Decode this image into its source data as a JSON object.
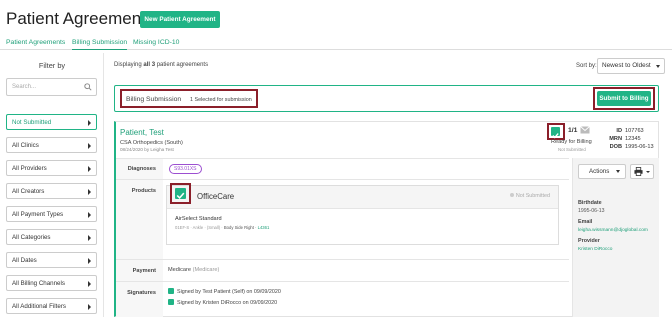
{
  "header": {
    "title": "Patient Agreements",
    "new_button": "New Patient Agreement"
  },
  "tabs": [
    {
      "label": "Patient Agreements"
    },
    {
      "label": "Billing Submission"
    },
    {
      "label": "Missing ICD-10"
    }
  ],
  "filters": {
    "title": "Filter by",
    "search_placeholder": "Search...",
    "items": [
      {
        "label": "Not Submitted"
      },
      {
        "label": "All Clinics"
      },
      {
        "label": "All Providers"
      },
      {
        "label": "All Creators"
      },
      {
        "label": "All Payment Types"
      },
      {
        "label": "All Categories"
      },
      {
        "label": "All Dates"
      },
      {
        "label": "All Billing Channels"
      },
      {
        "label": "All Additional Filters"
      }
    ]
  },
  "list": {
    "displaying_prefix": "Displaying",
    "displaying_count": "all 3",
    "displaying_suffix": "patient agreements",
    "sort_label": "Sort by:",
    "sort_value": "Newest to Oldest"
  },
  "billing_bar": {
    "label": "Billing Submission",
    "selected": "1 Selected for submission",
    "submit_button": "Submit to Billing"
  },
  "agreement": {
    "patient_name": "Patient, Test",
    "org": "CSA Orthopedics (South)",
    "date_line": "08/24/2020 by Leigha Test",
    "ready_count": "1/1",
    "ready_text": "Ready for Billing",
    "ready_sub": "Not Submitted",
    "id_label": "ID",
    "id_value": "107763",
    "mrn_label": "MRN",
    "mrn_value": "12345",
    "dob_label": "DOB",
    "dob_value": "1995-06-13",
    "diagnoses_label": "Diagnoses",
    "diagnosis_code": "S93.01XS",
    "products_label": "Products",
    "product_name": "OfficeCare",
    "product_status": "Not Submitted",
    "product_item": "AirSelect Standard",
    "product_detail_code": "01EF-S · Ankle · (Small) ·",
    "product_detail_side": "Body Side Right ·",
    "product_detail_hcpcs": "L4361",
    "payment_label": "Payment",
    "payment_value": "Medicare",
    "payment_sub": "(Medicare)",
    "signatures_label": "Signatures",
    "signatures": [
      {
        "text": "Signed by Test Patient (Self) on 09/09/2020"
      },
      {
        "text": "Signed by Kristen DiRocco on 09/09/2020"
      }
    ]
  },
  "side_panel": {
    "actions_label": "Actions",
    "birthdate_label": "Birthdate",
    "birthdate_value": "1995-06-13",
    "email_label": "Email",
    "email_value": "leigha.wissmann@djoglobal.com",
    "provider_label": "Provider",
    "provider_value": "Kristen DiRocco"
  },
  "colors": {
    "accent": "#20b486",
    "highlight_border": "#8b1f2a",
    "diagnosis_badge": "#9c4fd1"
  }
}
